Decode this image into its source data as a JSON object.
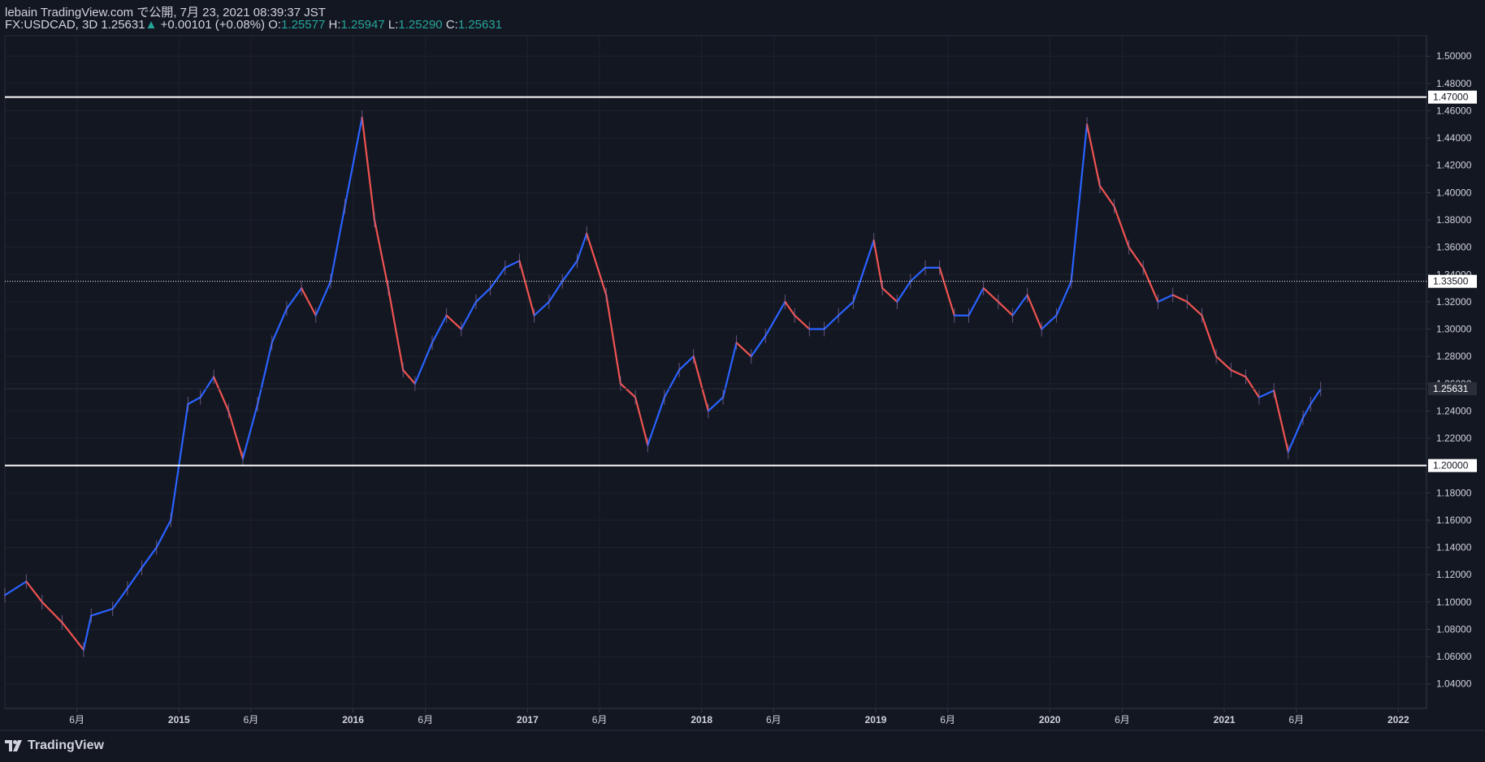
{
  "header": {
    "line1": "lebain TradingView.com で公開, 7月 23, 2021 08:39:37 JST",
    "symbol": "FX:USDCAD, 3D",
    "last": "1.25631",
    "change": "+0.00101 (+0.08%)",
    "o_label": "O:",
    "o_value": "1.25577",
    "h_label": "H:",
    "h_value": "1.25947",
    "l_label": "L:",
    "l_value": "1.25290",
    "c_label": "C:",
    "c_value": "1.25631"
  },
  "footer": {
    "brand": "TradingView"
  },
  "colors": {
    "bg": "#131722",
    "up": "#2962ff",
    "down": "#ef5350",
    "grid": "#1e222d",
    "text": "#d1d4dc",
    "accent": "#26a69a"
  },
  "chart_data": {
    "type": "line",
    "title": "FX:USDCAD, 3D",
    "x_ticks": [
      "6月",
      "2015",
      "6月",
      "2016",
      "6月",
      "2017",
      "6月",
      "2018",
      "6月",
      "2019",
      "6月",
      "2020",
      "6月",
      "2021",
      "6月",
      "2022"
    ],
    "y_ticks": [
      "1.50000",
      "1.48000",
      "1.46000",
      "1.44000",
      "1.42000",
      "1.40000",
      "1.38000",
      "1.36000",
      "1.34000",
      "1.32000",
      "1.30000",
      "1.28000",
      "1.26000",
      "1.24000",
      "1.22000",
      "1.20000",
      "1.18000",
      "1.16000",
      "1.14000",
      "1.12000",
      "1.10000",
      "1.08000",
      "1.06000",
      "1.04000"
    ],
    "ylim": [
      1.022,
      1.515
    ],
    "x_range": [
      "2014-01-01",
      "2022-03-01"
    ],
    "levels": [
      {
        "value": 1.47,
        "label": "1.47000",
        "style": "solid"
      },
      {
        "value": 1.335,
        "label": "1.33500",
        "style": "dotted"
      },
      {
        "value": 1.2,
        "label": "1.20000",
        "style": "solid"
      }
    ],
    "last_price": {
      "value": 1.25631,
      "label": "1.25631"
    },
    "series": [
      {
        "x": [
          "2014-01-01",
          "2014-02-15",
          "2014-03-20",
          "2014-05-01",
          "2014-06-15",
          "2014-07-01",
          "2014-08-15",
          "2014-09-15",
          "2014-10-15",
          "2014-11-15",
          "2014-12-15",
          "2015-01-20",
          "2015-02-15",
          "2015-03-15",
          "2015-04-15",
          "2015-05-15",
          "2015-06-15",
          "2015-07-15",
          "2015-08-15",
          "2015-09-15",
          "2015-10-15",
          "2015-11-15",
          "2015-12-15",
          "2016-01-20",
          "2016-02-15",
          "2016-03-15",
          "2016-04-15",
          "2016-05-10",
          "2016-06-15",
          "2016-07-15",
          "2016-08-15",
          "2016-09-15",
          "2016-10-15",
          "2016-11-15",
          "2016-12-15",
          "2017-01-15",
          "2017-02-15",
          "2017-03-15",
          "2017-04-15",
          "2017-05-05",
          "2017-06-15",
          "2017-07-15",
          "2017-08-15",
          "2017-09-10",
          "2017-10-15",
          "2017-11-15",
          "2017-12-15",
          "2018-01-15",
          "2018-02-15",
          "2018-03-15",
          "2018-04-15",
          "2018-05-15",
          "2018-06-25",
          "2018-07-15",
          "2018-08-15",
          "2018-09-15",
          "2018-10-15",
          "2018-11-15",
          "2018-12-28",
          "2019-01-15",
          "2019-02-15",
          "2019-03-15",
          "2019-04-15",
          "2019-05-15",
          "2019-06-15",
          "2019-07-15",
          "2019-08-15",
          "2019-09-15",
          "2019-10-15",
          "2019-11-15",
          "2019-12-15",
          "2020-01-15",
          "2020-02-15",
          "2020-03-19",
          "2020-04-15",
          "2020-05-15",
          "2020-06-15",
          "2020-07-15",
          "2020-08-15",
          "2020-09-15",
          "2020-10-15",
          "2020-11-15",
          "2020-12-15",
          "2021-01-15",
          "2021-02-15",
          "2021-03-15",
          "2021-04-15",
          "2021-05-15",
          "2021-06-15",
          "2021-07-01",
          "2021-07-22"
        ],
        "values": [
          1.105,
          1.115,
          1.1,
          1.085,
          1.065,
          1.09,
          1.095,
          1.11,
          1.125,
          1.14,
          1.16,
          1.245,
          1.25,
          1.265,
          1.24,
          1.205,
          1.245,
          1.29,
          1.315,
          1.33,
          1.31,
          1.335,
          1.39,
          1.455,
          1.38,
          1.33,
          1.27,
          1.26,
          1.29,
          1.31,
          1.3,
          1.32,
          1.33,
          1.345,
          1.35,
          1.31,
          1.32,
          1.335,
          1.35,
          1.37,
          1.325,
          1.26,
          1.25,
          1.215,
          1.25,
          1.27,
          1.28,
          1.24,
          1.25,
          1.29,
          1.28,
          1.295,
          1.32,
          1.31,
          1.3,
          1.3,
          1.31,
          1.32,
          1.365,
          1.33,
          1.32,
          1.335,
          1.345,
          1.345,
          1.31,
          1.31,
          1.33,
          1.32,
          1.31,
          1.325,
          1.3,
          1.31,
          1.335,
          1.45,
          1.405,
          1.39,
          1.36,
          1.345,
          1.32,
          1.325,
          1.32,
          1.31,
          1.28,
          1.27,
          1.265,
          1.25,
          1.255,
          1.21,
          1.235,
          1.245,
          1.256
        ]
      }
    ]
  }
}
